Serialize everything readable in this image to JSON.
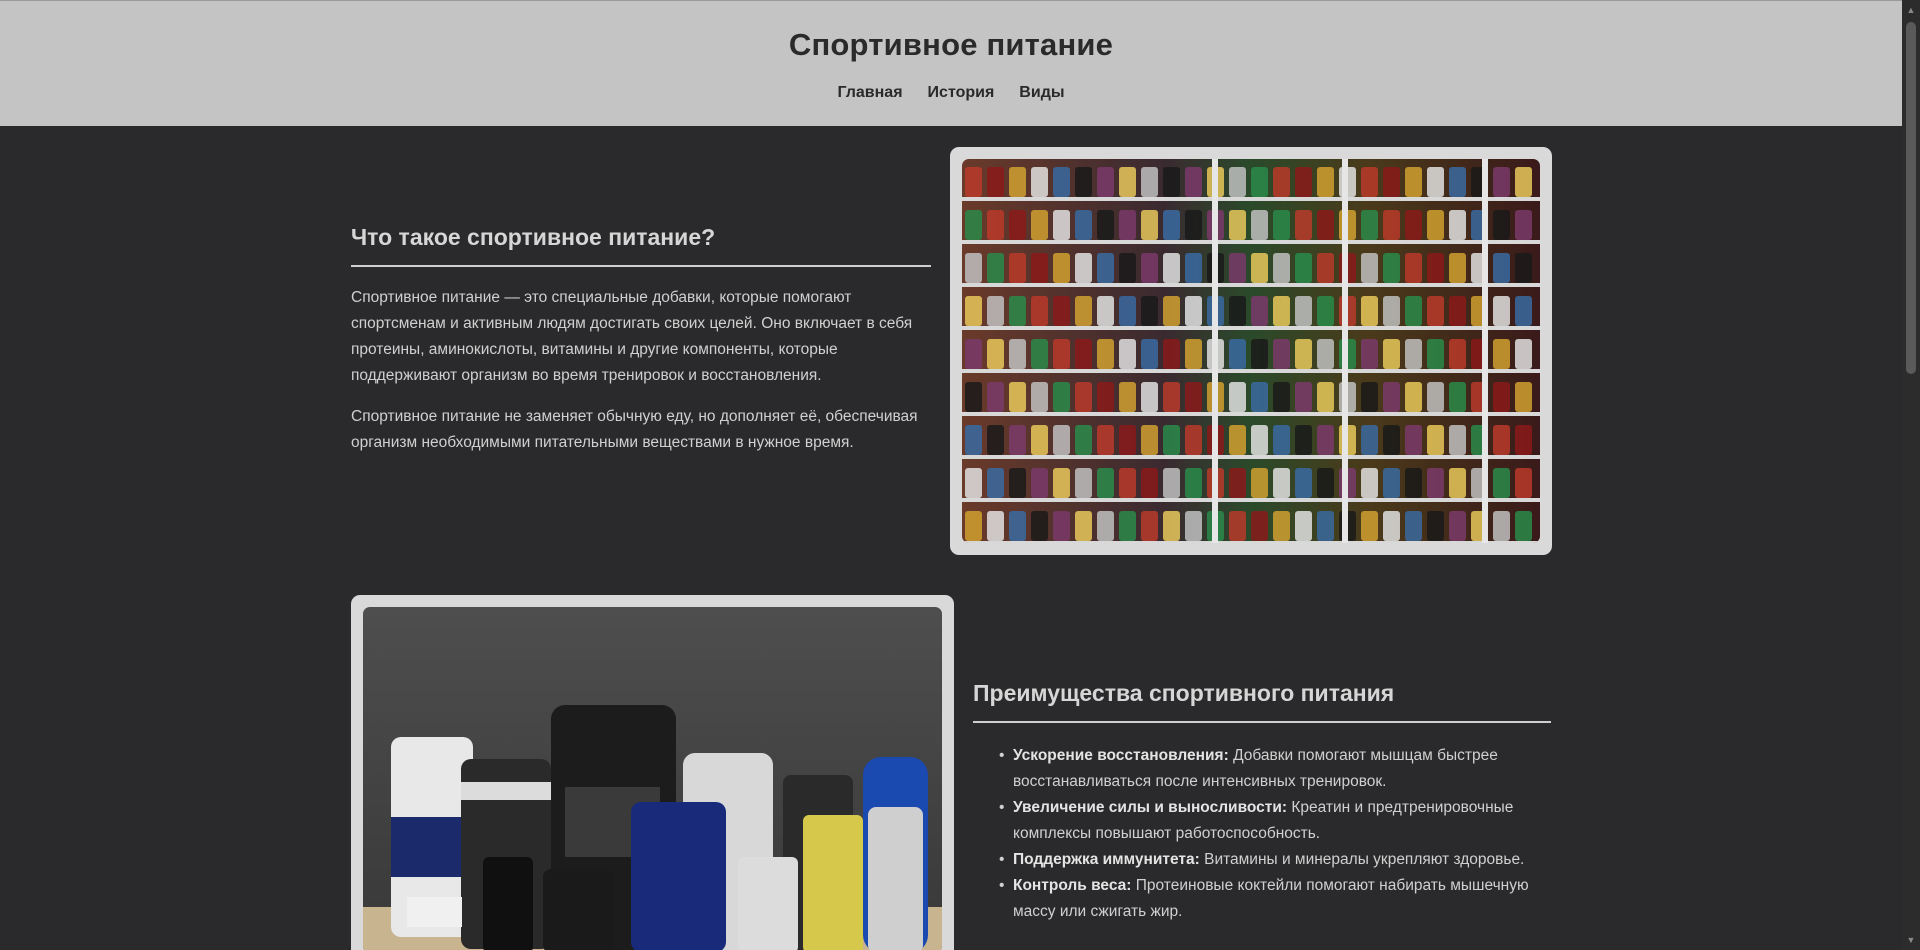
{
  "header": {
    "title": "Спортивное питание",
    "nav": [
      "Главная",
      "История",
      "Виды"
    ]
  },
  "section1": {
    "title": "Что такое спортивное питание?",
    "paragraphs": [
      "Спортивное питание — это специальные добавки, которые помогают спортсменам и активным людям достигать своих целей. Оно включает в себя протеины, аминокислоты, витамины и другие компоненты, которые поддерживают организм во время тренировок и восстановления.",
      "Спортивное питание не заменяет обычную еду, но дополняет её, обеспечивая организм необходимыми питательными веществами в нужное время."
    ]
  },
  "section2": {
    "title": "Преимущества спортивного питания",
    "items": [
      {
        "term": "Ускорение восстановления:",
        "text": "Добавки помогают мышцам быстрее восстанавливаться после интенсивных тренировок."
      },
      {
        "term": "Увеличение силы и выносливости:",
        "text": "Креатин и предтренировочные комплексы повышают работоспособность."
      },
      {
        "term": "Поддержка иммунитета:",
        "text": "Витамины и минералы укрепляют здоровье."
      },
      {
        "term": "Контроль веса:",
        "text": "Протеиновые коктейли помогают набирать мышечную массу или сжигать жир."
      }
    ]
  },
  "colors": {
    "header_bg": "#c4c4c4",
    "page_bg": "#2a2a2c",
    "frame_bg": "#d9d9d9"
  }
}
